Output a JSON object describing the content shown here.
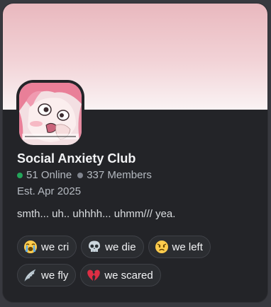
{
  "server": {
    "name": "Social Anxiety Club",
    "online_count": "51 Online",
    "member_count": "337 Members",
    "established": "Est. Apr 2025",
    "description": "smth... uh.. uhhhh... uhmm/// yea.",
    "icon_caption": "Social Anxiety Club server icon"
  },
  "colors": {
    "online_dot": "#23a55a",
    "members_dot": "#80848e",
    "banner_top": "#e9b8be",
    "banner_bottom": "#faf3f4",
    "card_bg": "#232428"
  },
  "tags": [
    {
      "emoji": "loudly-crying-face",
      "label": "we cri"
    },
    {
      "emoji": "skull",
      "label": "we die"
    },
    {
      "emoji": "angry-face",
      "label": "we left"
    },
    {
      "emoji": "wing",
      "label": "we fly"
    },
    {
      "emoji": "broken-heart",
      "label": "we scared"
    }
  ]
}
